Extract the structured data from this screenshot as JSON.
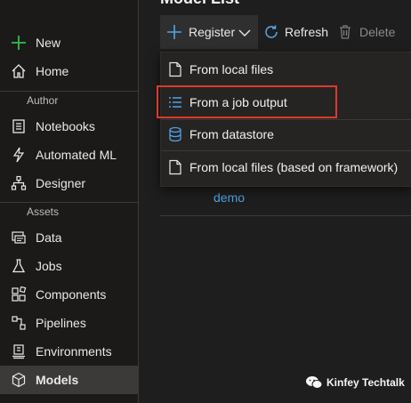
{
  "sidebar": {
    "top_items": [
      {
        "label": "New",
        "icon": "plus-icon"
      },
      {
        "label": "Home",
        "icon": "home-icon"
      }
    ],
    "sections": [
      {
        "label": "Author",
        "items": [
          {
            "label": "Notebooks",
            "icon": "notebook-icon"
          },
          {
            "label": "Automated ML",
            "icon": "automl-icon"
          },
          {
            "label": "Designer",
            "icon": "designer-icon"
          }
        ]
      },
      {
        "label": "Assets",
        "items": [
          {
            "label": "Data",
            "icon": "data-icon"
          },
          {
            "label": "Jobs",
            "icon": "flask-icon"
          },
          {
            "label": "Components",
            "icon": "components-icon"
          },
          {
            "label": "Pipelines",
            "icon": "pipelines-icon"
          },
          {
            "label": "Environments",
            "icon": "environments-icon"
          },
          {
            "label": "Models",
            "icon": "cube-icon",
            "active": true
          }
        ]
      }
    ]
  },
  "main": {
    "title": "Model List",
    "toolbar": {
      "register_label": "Register",
      "refresh_label": "Refresh",
      "delete_label": "Delete"
    },
    "rows": [
      {
        "name": "demo"
      }
    ]
  },
  "register_menu": {
    "items": [
      {
        "label": "From local files",
        "icon": "file-icon"
      },
      {
        "label": "From a job output",
        "icon": "list-icon",
        "highlighted": true
      },
      {
        "label": "From datastore",
        "icon": "datastore-icon"
      },
      {
        "label": "From local files (based on framework)",
        "icon": "file-icon"
      }
    ]
  },
  "watermark": {
    "text": "Kinfey Techtalk"
  },
  "colors": {
    "accent": "#4fa3e8",
    "new_plus": "#2fbf4a",
    "highlight_border": "#e0382c",
    "active_bg": "#3b3a39"
  }
}
